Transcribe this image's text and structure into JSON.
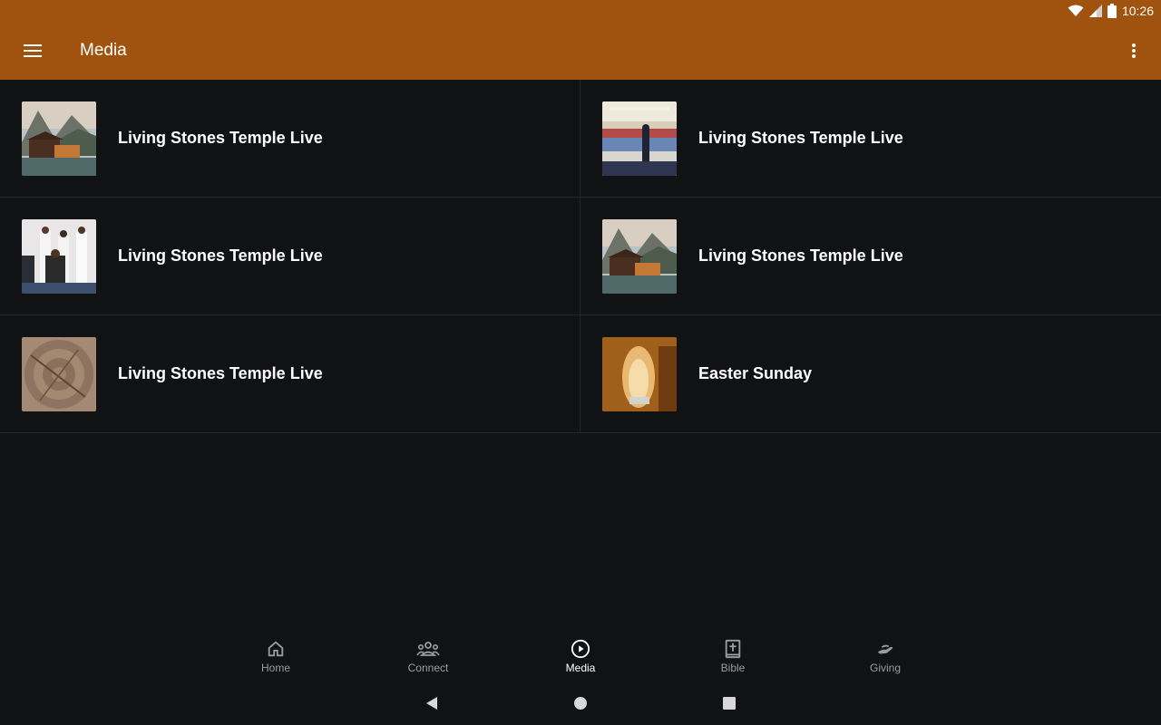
{
  "status_bar": {
    "time": "10:26",
    "icons": [
      "wifi-icon",
      "signal-icon",
      "battery-icon"
    ]
  },
  "app_bar": {
    "title": "Media",
    "menu_icon": "hamburger-menu-icon",
    "overflow_icon": "more-vert-icon",
    "color": "#a0520f"
  },
  "media_items": [
    {
      "title": "Living Stones Temple Live",
      "thumbnail": "lake-cabin-mountains"
    },
    {
      "title": "Living Stones Temple Live",
      "thumbnail": "church-congregation"
    },
    {
      "title": "Living Stones Temple Live",
      "thumbnail": "choir-singing"
    },
    {
      "title": "Living Stones Temple Live",
      "thumbnail": "lake-cabin-mountains"
    },
    {
      "title": "Living Stones Temple Live",
      "thumbnail": "wood-texture"
    },
    {
      "title": "Easter Sunday",
      "thumbnail": "empty-tomb"
    }
  ],
  "bottom_nav": [
    {
      "label": "Home",
      "icon": "home-icon",
      "active": false
    },
    {
      "label": "Connect",
      "icon": "people-icon",
      "active": false
    },
    {
      "label": "Media",
      "icon": "play-circle-icon",
      "active": true
    },
    {
      "label": "Bible",
      "icon": "bible-icon",
      "active": false
    },
    {
      "label": "Giving",
      "icon": "giving-hand-icon",
      "active": false
    }
  ],
  "system_nav": [
    "back-icon",
    "home-circle-icon",
    "recents-square-icon"
  ]
}
